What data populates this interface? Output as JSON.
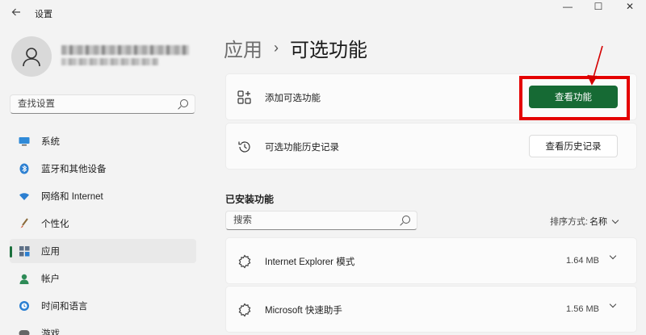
{
  "window": {
    "title": "设置",
    "controls": {
      "minimize": "—",
      "maximize": "☐",
      "close": "✕"
    }
  },
  "sidebar": {
    "search_placeholder": "查找设置",
    "items": [
      {
        "label": "系统",
        "icon": "monitor-icon"
      },
      {
        "label": "蓝牙和其他设备",
        "icon": "bluetooth-icon"
      },
      {
        "label": "网络和 Internet",
        "icon": "wifi-icon"
      },
      {
        "label": "个性化",
        "icon": "brush-icon"
      },
      {
        "label": "应用",
        "icon": "apps-icon",
        "active": true
      },
      {
        "label": "帐户",
        "icon": "person-icon"
      },
      {
        "label": "时间和语言",
        "icon": "globe-clock-icon"
      },
      {
        "label": "游戏",
        "icon": "game-icon"
      }
    ]
  },
  "breadcrumb": {
    "parent": "应用",
    "separator": "›",
    "current": "可选功能"
  },
  "add_card": {
    "label": "添加可选功能",
    "button": "查看功能"
  },
  "history_card": {
    "label": "可选功能历史记录",
    "button": "查看历史记录"
  },
  "installed": {
    "title": "已安装功能",
    "search_placeholder": "搜索",
    "sort_label": "排序方式:",
    "sort_value": "名称",
    "features": [
      {
        "name": "Internet Explorer 模式",
        "size": "1.64 MB"
      },
      {
        "name": "Microsoft 快速助手",
        "size": "1.56 MB"
      }
    ]
  },
  "colors": {
    "accent": "#166a34",
    "highlight": "#e40000"
  }
}
